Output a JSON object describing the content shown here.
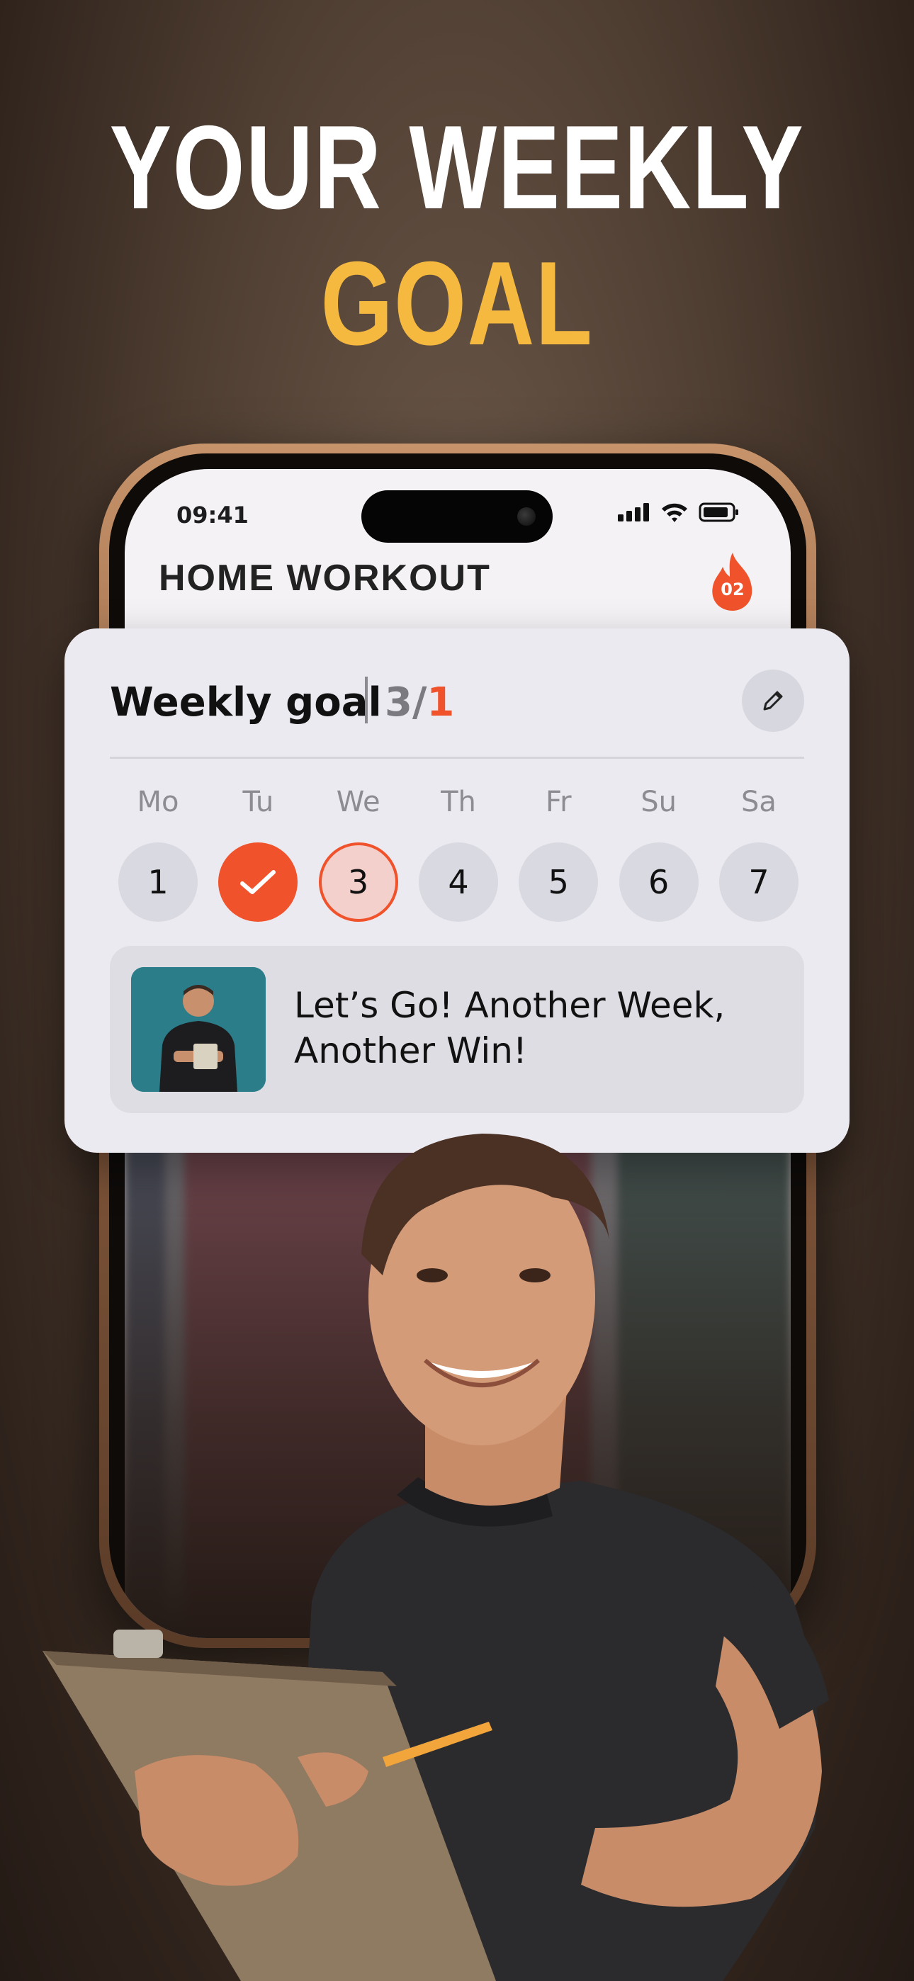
{
  "headline": {
    "line1": "YOUR WEEKLY",
    "line2": "GOAL"
  },
  "status_bar": {
    "time": "09:41"
  },
  "app": {
    "title": "HOME WORKOUT",
    "streak": "02"
  },
  "weekly_goal": {
    "title": "Weekly goal",
    "count_done": "3/",
    "count_target": "1",
    "days": [
      {
        "label": "Mo",
        "number": "1",
        "state": "default"
      },
      {
        "label": "Tu",
        "number": "",
        "state": "done"
      },
      {
        "label": "We",
        "number": "3",
        "state": "today"
      },
      {
        "label": "Th",
        "number": "4",
        "state": "default"
      },
      {
        "label": "Fr",
        "number": "5",
        "state": "default"
      },
      {
        "label": "Su",
        "number": "6",
        "state": "default"
      },
      {
        "label": "Sa",
        "number": "7",
        "state": "default"
      }
    ],
    "promo_text": "Let’s Go! Another Week, Another Win!"
  },
  "colors": {
    "accent": "#f0532b",
    "headline_gold": "#f6b940",
    "card_bg": "#eceaf1"
  },
  "icons": [
    "flame-icon",
    "edit-pencil-icon",
    "checkmark-icon",
    "signal-icon",
    "wifi-icon",
    "battery-icon"
  ]
}
